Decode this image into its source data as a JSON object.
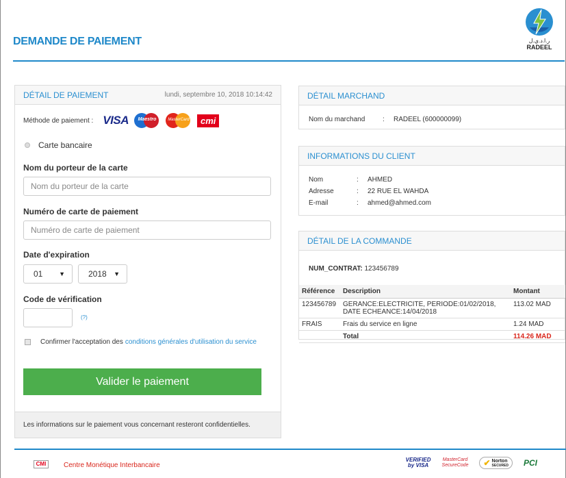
{
  "header": {
    "title": "DEMANDE DE PAIEMENT",
    "logo_arabic": "ر.ا.د.ي.ل",
    "logo_name": "RADEEL"
  },
  "payment": {
    "panel_title": "DÉTAIL DE PAIEMENT",
    "datetime": "lundi, septembre 10, 2018 10:14:42",
    "method_label": "Méthode de paiement :",
    "brands": {
      "visa": "VISA",
      "maestro": "Maestro",
      "mastercard": "MasterCard",
      "cmi": "cmi"
    },
    "method_option": "Carte bancaire",
    "holder_label": "Nom du porteur de la carte",
    "holder_placeholder": "Nom du porteur de la carte",
    "card_label": "Numéro de carte de paiement",
    "card_placeholder": "Numéro de carte de paiement",
    "expiry_label": "Date d'expiration",
    "expiry_month": "01",
    "expiry_year": "2018",
    "cvv_label": "Code de vérification",
    "cvv_help": "(?)",
    "terms_prefix": "Confirmer l'acceptation des",
    "terms_link": "conditions générales d'utilisation du service",
    "submit_label": "Valider le paiement",
    "confidential_note": "Les informations sur le paiement vous concernant resteront confidentielles."
  },
  "merchant": {
    "panel_title": "DÉTAIL MARCHAND",
    "name_label": "Nom du marchand",
    "sep": ":",
    "name_value": "RADEEL (600000099)"
  },
  "client": {
    "panel_title": "INFORMATIONS DU CLIENT",
    "sep": ":",
    "nom_label": "Nom",
    "nom_value": "AHMED",
    "adresse_label": "Adresse",
    "adresse_value": "22 RUE EL WAHDA",
    "email_label": "E-mail",
    "email_value": "ahmed@ahmed.com"
  },
  "order": {
    "panel_title": "DÉTAIL DE LA COMMANDE",
    "contract_label": "NUM_CONTRAT:",
    "contract_value": "123456789",
    "headers": {
      "ref": "Référence",
      "desc": "Description",
      "amount": "Montant"
    },
    "rows": [
      {
        "ref": "123456789",
        "desc": "GERANCE:ELECTRICITE, PERIODE:01/02/2018, DATE ECHEANCE:14/04/2018",
        "amount": "113.02 MAD"
      },
      {
        "ref": "FRAIS",
        "desc": "Frais du service en ligne",
        "amount": "1.24 MAD"
      }
    ],
    "total_label": "Total",
    "total_value": "114.26 MAD"
  },
  "footer": {
    "cmi_logo": "CMI",
    "cmi_text": "Centre Monétique Interbancaire",
    "vbv_line1": "VERIFIED",
    "vbv_line2": "by VISA",
    "mcsc_line1": "MasterCard",
    "mcsc_line2": "SecureCode",
    "norton": "Norton",
    "norton_sub": "SECURED",
    "pci": "PCI"
  },
  "colors": {
    "accent": "#1e88c9",
    "submit": "#4cae4c",
    "red": "#d9261c"
  }
}
